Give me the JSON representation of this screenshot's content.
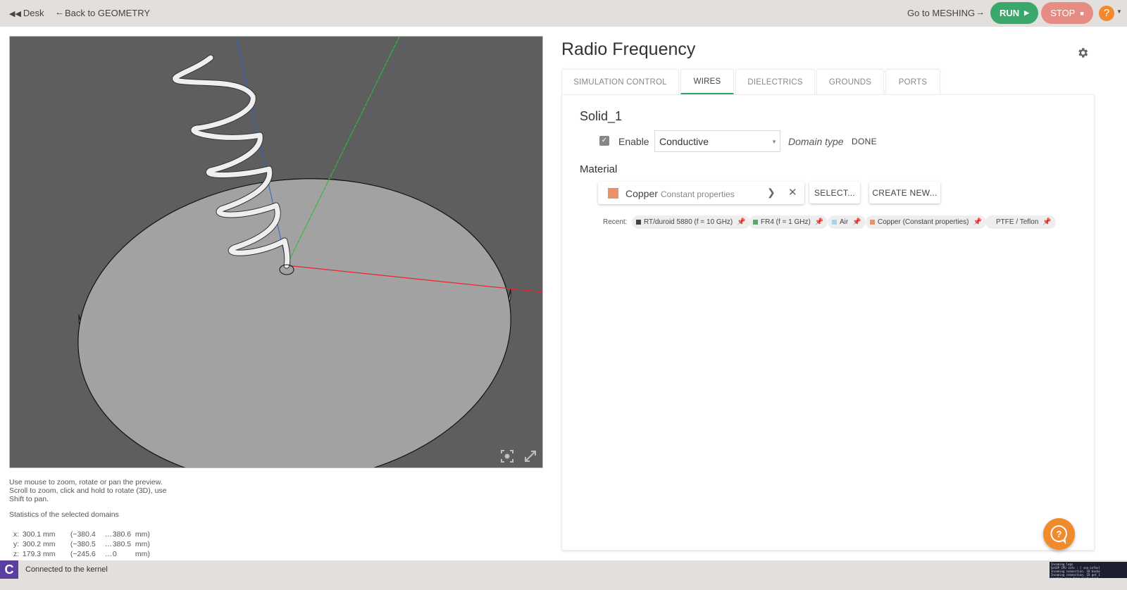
{
  "topbar": {
    "desk_label": "Desk",
    "back_label": "Back to GEOMETRY",
    "next_label": "Go to MESHING",
    "run_label": "RUN",
    "stop_label": "STOP",
    "help_label": "?",
    "icons": {
      "desk": "double-arrow-left-icon",
      "back": "arrow-left-icon",
      "next": "arrow-right-icon",
      "run": "play-icon",
      "stop": "stop-icon"
    }
  },
  "viewport": {
    "tools": [
      "focus-icon",
      "expand-icon"
    ],
    "axis_colors": {
      "x": "#e8262a",
      "y": "#2dbb3a",
      "z": "#2e67c9"
    }
  },
  "hint": {
    "text": "Use mouse to zoom, rotate or pan the preview. Scroll to zoom, click and hold to rotate (3D), use Shift to pan."
  },
  "stats": {
    "title": "Statistics of the selected domains",
    "rows": [
      {
        "axis": "x:",
        "size": "300.1 mm",
        "min": "(−380.4",
        "max": "380.6",
        "unit": "mm)"
      },
      {
        "axis": "y:",
        "size": "300.2 mm",
        "min": "(−380.5",
        "max": "380.5",
        "unit": "mm)"
      },
      {
        "axis": "z:",
        "size": "179.3 mm",
        "min": "(−245.6",
        "max": "0",
        "unit": "mm)"
      }
    ],
    "sep": "…"
  },
  "statusbar": {
    "logo": "C",
    "text": "Connected to the kernel",
    "console_lines": [
      "Incoming logs",
      "GetDP CPU info : [ <no-info>]",
      "Incoming connection. ID backe",
      "Incoming connection. ID got 1",
      "Loading case from C:\\Users\\A"
    ]
  },
  "panel": {
    "title": "Radio Frequency",
    "tabs": [
      {
        "label": "SIMULATION CONTROL",
        "active": false
      },
      {
        "label": "WIRES",
        "active": true
      },
      {
        "label": "DIELECTRICS",
        "active": false
      },
      {
        "label": "GROUNDS",
        "active": false
      },
      {
        "label": "PORTS",
        "active": false
      }
    ],
    "domain": {
      "name": "Solid_1",
      "enable_label": "Enable",
      "enabled": true,
      "type_value": "Conductive",
      "type_label": "Domain type",
      "done_label": "DONE"
    },
    "material": {
      "label": "Material",
      "name": "Copper",
      "subtitle": "Constant properties",
      "color": "#e8916a",
      "select_label": "SELECT...",
      "create_label": "CREATE NEW..."
    },
    "recent": {
      "label": "Recent:",
      "items": [
        {
          "label": "RT/duroid 5880 (f = 10 GHz)",
          "color": "#444444",
          "pinned": true
        },
        {
          "label": "FR4 (f = 1 GHz)",
          "color": "#5aa86a",
          "pinned": true
        },
        {
          "label": "Air",
          "color": "#a9d3ea",
          "pinned": true
        },
        {
          "label": "Copper (Constant properties)",
          "color": "#e8916a",
          "pinned": true
        },
        {
          "label": "PTFE / Teflon",
          "color": "",
          "pinned": true
        }
      ]
    }
  },
  "colors": {
    "run": "#3aa86b",
    "stop": "#e78c83",
    "help": "#f08a2c",
    "active_tab": "#2ea563"
  }
}
